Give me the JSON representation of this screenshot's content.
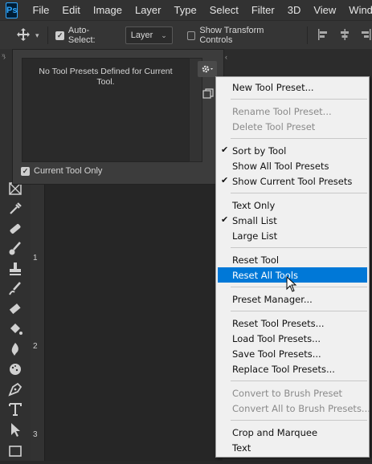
{
  "app": {
    "logo_text": "Ps",
    "accent": "#31a8ff"
  },
  "menubar": {
    "items": [
      "File",
      "Edit",
      "Image",
      "Layer",
      "Type",
      "Select",
      "Filter",
      "3D",
      "View",
      "Window"
    ]
  },
  "options": {
    "auto_select_label": "Auto-Select:",
    "auto_select_checked": true,
    "auto_select_target": "Layer",
    "transform_label": "Show Transform Controls",
    "transform_checked": false
  },
  "panel": {
    "empty_message": "No Tool Presets Defined for Current Tool.",
    "current_tool_only_label": "Current Tool Only",
    "current_tool_only_checked": true
  },
  "rulers": {
    "vertical_marks": [
      "1",
      "2",
      "3"
    ]
  },
  "context_menu": {
    "highlight_color": "#0078d7",
    "items": [
      {
        "label": "New Tool Preset...",
        "checked": false,
        "disabled": false,
        "highlighted": false
      },
      {
        "label": "Rename Tool Preset...",
        "checked": false,
        "disabled": true,
        "highlighted": false
      },
      {
        "label": "Delete Tool Preset",
        "checked": false,
        "disabled": true,
        "highlighted": false
      },
      {
        "label": "Sort by Tool",
        "checked": true,
        "disabled": false,
        "highlighted": false
      },
      {
        "label": "Show All Tool Presets",
        "checked": false,
        "disabled": false,
        "highlighted": false
      },
      {
        "label": "Show Current Tool Presets",
        "checked": true,
        "disabled": false,
        "highlighted": false
      },
      {
        "label": "Text Only",
        "checked": false,
        "disabled": false,
        "highlighted": false
      },
      {
        "label": "Small List",
        "checked": true,
        "disabled": false,
        "highlighted": false
      },
      {
        "label": "Large List",
        "checked": false,
        "disabled": false,
        "highlighted": false
      },
      {
        "label": "Reset Tool",
        "checked": false,
        "disabled": false,
        "highlighted": false
      },
      {
        "label": "Reset All Tools",
        "checked": false,
        "disabled": false,
        "highlighted": true
      },
      {
        "label": "Preset Manager...",
        "checked": false,
        "disabled": false,
        "highlighted": false
      },
      {
        "label": "Reset Tool Presets...",
        "checked": false,
        "disabled": false,
        "highlighted": false
      },
      {
        "label": "Load Tool Presets...",
        "checked": false,
        "disabled": false,
        "highlighted": false
      },
      {
        "label": "Save Tool Presets...",
        "checked": false,
        "disabled": false,
        "highlighted": false
      },
      {
        "label": "Replace Tool Presets...",
        "checked": false,
        "disabled": false,
        "highlighted": false
      },
      {
        "label": "Convert to Brush Preset",
        "checked": false,
        "disabled": true,
        "highlighted": false
      },
      {
        "label": "Convert All to Brush Presets...",
        "checked": false,
        "disabled": true,
        "highlighted": false
      },
      {
        "label": "Crop and Marquee",
        "checked": false,
        "disabled": false,
        "highlighted": false
      },
      {
        "label": "Text",
        "checked": false,
        "disabled": false,
        "highlighted": false
      }
    ]
  }
}
